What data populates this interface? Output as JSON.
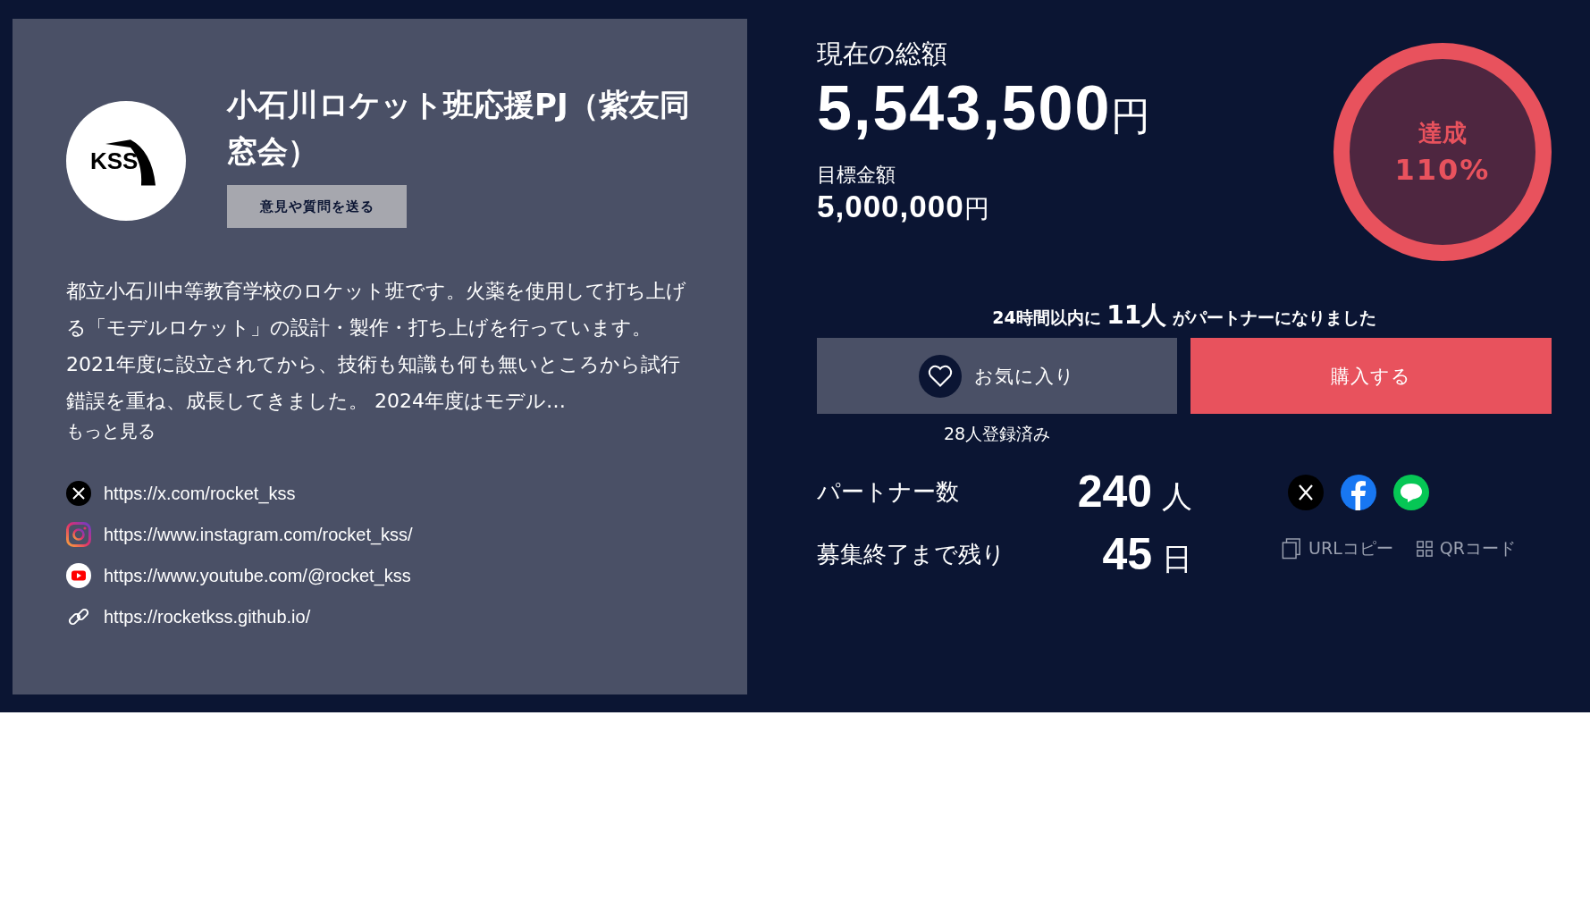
{
  "project": {
    "logo_text": "KSS",
    "title": "小石川ロケット班応援PJ（紫友同窓会）",
    "contact_button": "意見や質問を送る",
    "description": "都立小石川中等教育学校のロケット班です。火薬を使用して打ち上げる「モデルロケット」の設計・製作・打ち上げを行っています。 2021年度に設立されてから、技術も知識も何も無いところから試行錯誤を重ね、成長してきました。 2024年度はモデル…",
    "more_link": "もっと見る",
    "links": [
      {
        "kind": "x",
        "url": "https://x.com/rocket_kss"
      },
      {
        "kind": "instagram",
        "url": "https://www.instagram.com/rocket_kss/"
      },
      {
        "kind": "youtube",
        "url": "https://www.youtube.com/@rocket_kss"
      },
      {
        "kind": "web",
        "url": "https://rocketkss.github.io/"
      }
    ]
  },
  "funding": {
    "current_label": "現在の総額",
    "current_amount": "5,543,500",
    "current_unit": "円",
    "goal_label": "目標金額",
    "goal_amount": "5,000,000",
    "goal_unit": "円",
    "achievement_label": "達成",
    "achievement_percent": "110%"
  },
  "recent": {
    "prefix": "24時間以内に",
    "count": "11人",
    "suffix": "がパートナーになりました"
  },
  "actions": {
    "favorite": "お気に入り",
    "favorite_count": "28人登録済み",
    "buy": "購入する"
  },
  "stats": [
    {
      "label": "パートナー数",
      "value": "240",
      "unit": "人"
    },
    {
      "label": "募集終了まで残り",
      "value": "45",
      "unit": "日"
    }
  ],
  "share": {
    "icons": [
      {
        "kind": "x"
      },
      {
        "kind": "facebook"
      },
      {
        "kind": "line"
      }
    ],
    "url_copy": "URLコピー",
    "qr_code": "QRコード"
  }
}
